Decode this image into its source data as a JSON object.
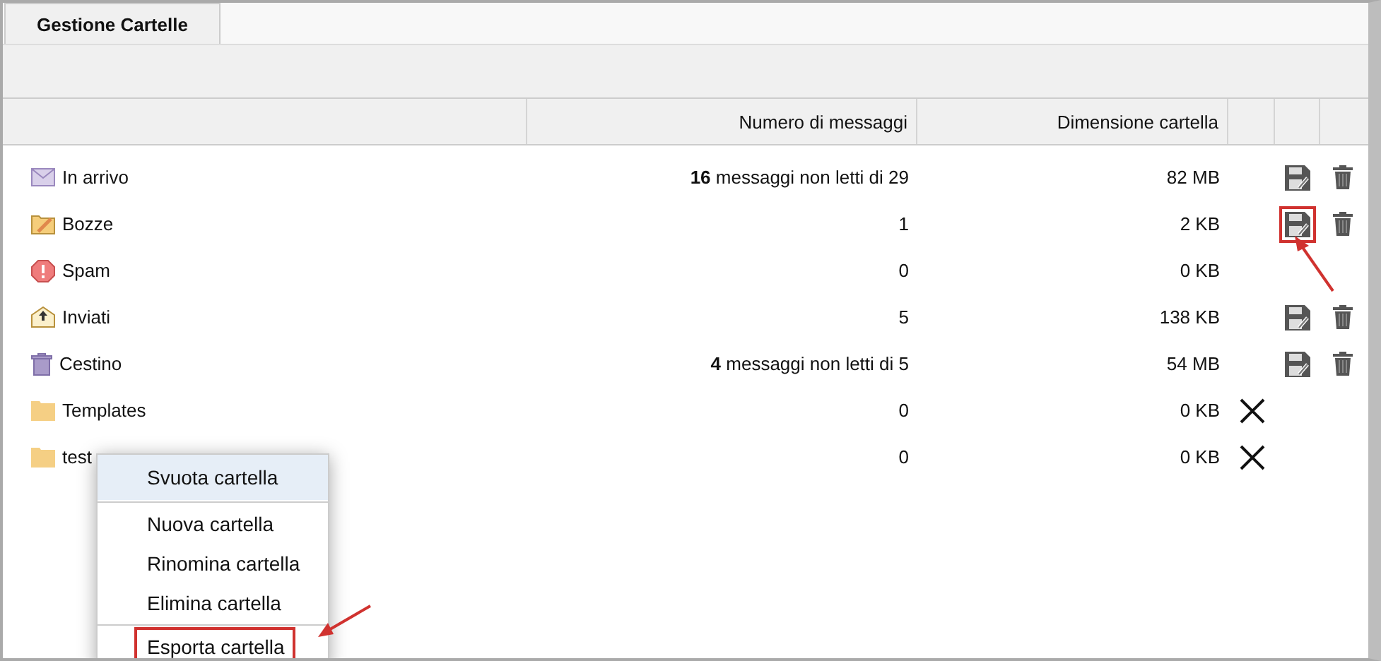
{
  "tabs": [
    {
      "label": "Gestione Cartelle",
      "selected": true
    }
  ],
  "table": {
    "columns": [
      "Numero di messaggi",
      "Dimensione cartella"
    ],
    "rows": [
      {
        "name": "In arrivo",
        "kind": "inbox",
        "messages": "**16** messaggi non letti di 29",
        "size": "82 MB",
        "exportable": true,
        "deletable": true,
        "removable": false,
        "annotated": false
      },
      {
        "name": "Bozze",
        "kind": "drafts",
        "messages": "1",
        "size": "2 KB",
        "exportable": true,
        "deletable": true,
        "removable": false,
        "annotated": true
      },
      {
        "name": "Spam",
        "kind": "spam",
        "messages": "0",
        "size": "0 KB",
        "exportable": false,
        "deletable": false,
        "removable": false,
        "annotated": false
      },
      {
        "name": "Inviati",
        "kind": "sent",
        "messages": "5",
        "size": "138 KB",
        "exportable": true,
        "deletable": true,
        "removable": false,
        "annotated": false
      },
      {
        "name": "Cestino",
        "kind": "trash",
        "messages": "**4** messaggi non letti di 5",
        "size": "54 MB",
        "exportable": true,
        "deletable": true,
        "removable": false,
        "annotated": false
      },
      {
        "name": "Templates",
        "kind": "folder",
        "messages": "0",
        "size": "0 KB",
        "exportable": false,
        "deletable": false,
        "removable": true,
        "annotated": false
      },
      {
        "name": "test",
        "kind": "folder",
        "messages": "0",
        "size": "0 KB",
        "exportable": false,
        "deletable": false,
        "removable": true,
        "annotated": false
      }
    ]
  },
  "context_menu": {
    "items": [
      {
        "label": "Svuota cartella",
        "selected": true,
        "annotated": false
      },
      {
        "label": "Nuova cartella",
        "selected": false,
        "annotated": false
      },
      {
        "label": "Rinomina cartella",
        "selected": false,
        "annotated": false
      },
      {
        "label": "Elimina cartella",
        "selected": false,
        "annotated": false
      },
      {
        "label": "Esporta cartella",
        "selected": false,
        "annotated": true
      }
    ]
  }
}
